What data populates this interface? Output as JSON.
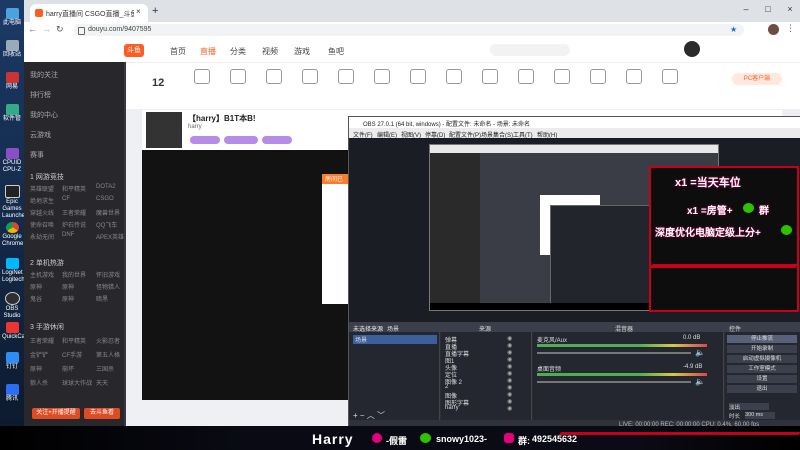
{
  "desktop": {
    "icons": [
      "此电脑",
      "回收站",
      "网易",
      "回收",
      "软件管",
      "CPUID CPU-Z",
      "Epic Games Launcher",
      "Google Chrome",
      "LogiNet Logitech",
      "OBS Studio",
      "QuickCast",
      "钉钉",
      "腾讯"
    ]
  },
  "browser": {
    "tab_title": "harry直播间 CSGO直播_斗鱼",
    "url": "douyu.com/9407595"
  },
  "douyu": {
    "logo": "斗鱼",
    "nav": [
      "首页",
      "直播",
      "分类",
      "视频",
      "游戏",
      "鱼吧"
    ],
    "streamer_title": "【harry】B1T本B!",
    "streamer_name": "harry",
    "level": "12",
    "follow_btn": "PC客户端"
  },
  "popup": {
    "header": "房间已"
  },
  "sidebar": {
    "items": [
      "我的关注",
      "排行榜",
      "我的中心",
      "云游戏",
      "赛事"
    ],
    "section1": "1 网游竞技",
    "section1_rows": [
      [
        "英雄联盟",
        "和平精英",
        "DOTA2"
      ],
      [
        "绝地求生",
        "CF",
        "CSGO"
      ],
      [
        "穿越火线",
        "王者荣耀",
        "魔兽世界"
      ],
      [
        "使命召唤",
        "炉石传说",
        "QQ飞车"
      ],
      [
        "永劫无间",
        "DNF",
        "APEX英雄"
      ]
    ],
    "section2": "2 单机热游",
    "section2_rows": [
      [
        "主机游戏",
        "我的世界",
        "怀旧游戏"
      ],
      [
        "原神",
        "原神",
        "怪物猎人"
      ],
      [
        "鬼谷",
        "原神",
        "暗黑"
      ]
    ],
    "section3": "3 手游休闲",
    "section3_rows": [
      [
        "王者荣耀",
        "和平精英",
        "火影忍者"
      ],
      [
        "金铲铲",
        "CF手游",
        "第五人格"
      ],
      [
        "原神",
        "崩坏",
        "三国杀"
      ],
      [
        "狼人杀",
        "球球大作战",
        "天天"
      ]
    ],
    "btn1": "关注+开播提醒",
    "btn2": "去斗鱼看"
  },
  "obs": {
    "title": "OBS 27.0.1 (64 bit, windows) - 配置文件: 未命名 - 场景: 未命名",
    "menu": [
      "文件(F)",
      "编辑(E)",
      "视图(V)",
      "停靠(D)",
      "配置文件(P)",
      "场景集合(S)",
      "工具(T)",
      "帮助(H)"
    ],
    "overlay_line1": "x1 =当天车位",
    "overlay_line2": "x1 =房管+",
    "overlay_line2b": "群",
    "overlay_line3": "深度优化电脑定级上分+",
    "docks": [
      "场景",
      "来源",
      "混音器",
      "转场特效",
      "控件"
    ],
    "scene_item": "场景",
    "sources": [
      "弹幕",
      "直播",
      "直播字幕",
      "图1",
      "头像",
      "定位",
      "图像 2",
      "2",
      "图像",
      "图形字幕",
      "harry"
    ],
    "mixer": [
      {
        "name": "桌面音频",
        "db": "-4.9 dB"
      },
      {
        "name": "麦克风/Aux",
        "db": "0.0 dB"
      }
    ],
    "controls": [
      "停止推流",
      "开始录制",
      "启动虚拟摄像机",
      "工作室模式",
      "设置",
      "退出"
    ],
    "transition": "淡出",
    "duration_label": "时长",
    "duration": "300 ms",
    "status": "LIVE: 00:00:00   REC: 00:00:00   CPU: 0.4%, 60.00 fps",
    "no_source": "未选择来源"
  },
  "banner": {
    "name": "Harry",
    "douyin": "-假雷",
    "wechat": "snowy1023-",
    "group_label": "群:",
    "group": "492545632"
  },
  "colors": {
    "douyu_orange": "#ff5d23",
    "obs_bg": "#2b2e38",
    "banner_red": "#c4001c",
    "overlay_pink": "#e3007a"
  }
}
